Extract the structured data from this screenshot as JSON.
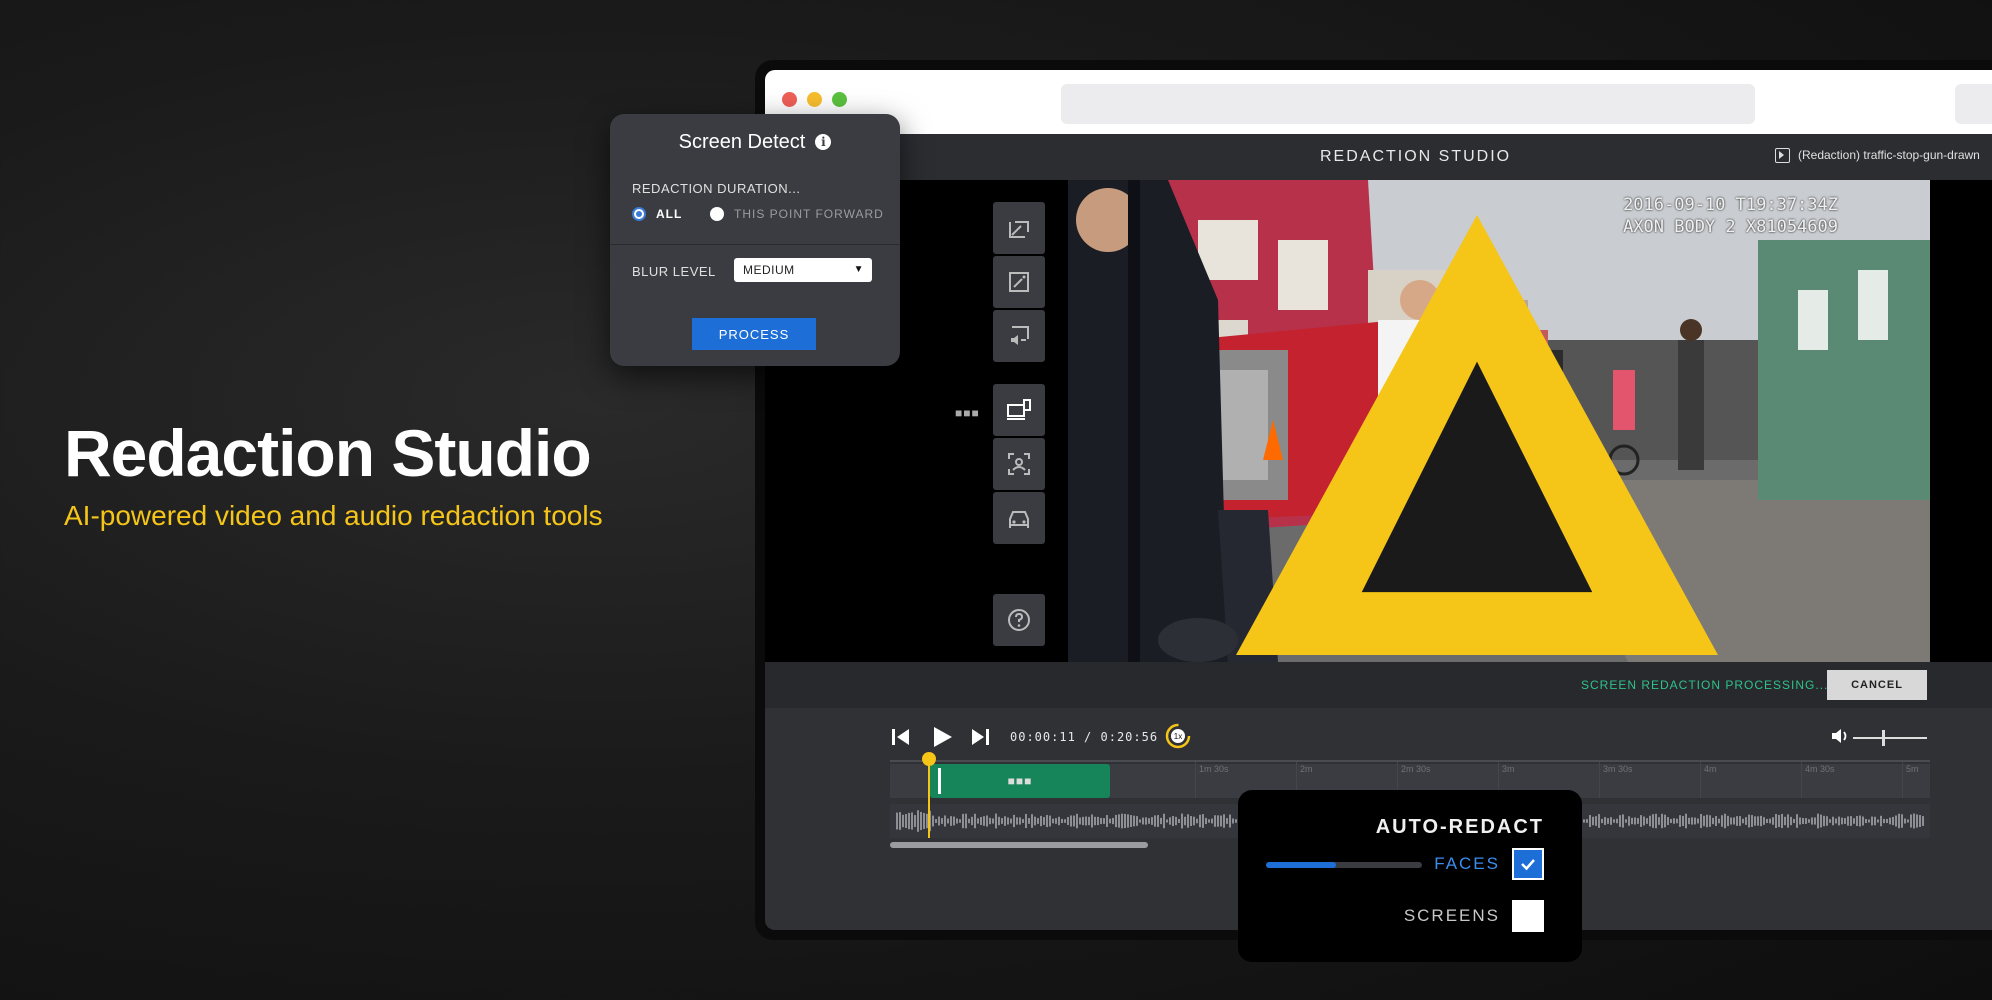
{
  "hero": {
    "title": "Redaction Studio",
    "subtitle": "AI-powered video and audio redaction tools"
  },
  "app": {
    "title": "REDACTION STUDIO",
    "file_name": "(Redaction) traffic-stop-gun-drawn"
  },
  "video": {
    "timestamp_line1": "2016-09-10 T19:37:34Z",
    "timestamp_line2": "AXON BODY 2 X81054609"
  },
  "toolbar": {
    "tools": [
      "draw-box-icon",
      "magic-wand-icon",
      "audio-redact-icon",
      "screen-detect-icon",
      "face-detect-icon",
      "vehicle-detect-icon"
    ],
    "help": "help-icon"
  },
  "status": {
    "text": "SCREEN REDACTION PROCESSING...",
    "cancel_label": "CANCEL"
  },
  "playback": {
    "current_time": "00:00:11",
    "separator": "/",
    "duration": "0:20:56",
    "speed": "1x",
    "volume_level": 0.4
  },
  "timeline": {
    "tick_labels": [
      "1m 30s",
      "2m",
      "2m 30s",
      "3m",
      "3m 30s",
      "4m",
      "4m 30s",
      "5m"
    ]
  },
  "screen_detect_panel": {
    "title": "Screen Detect",
    "duration_label": "REDACTION DURATION...",
    "option_all": "ALL",
    "option_forward": "THIS POINT FORWARD",
    "selected_option": "ALL",
    "blur_label": "BLUR LEVEL",
    "blur_value": "MEDIUM",
    "process_label": "PROCESS"
  },
  "auto_redact": {
    "title": "AUTO-REDACT",
    "faces_label": "FACES",
    "faces_checked": true,
    "faces_progress": 0.45,
    "screens_label": "SCREENS",
    "screens_checked": false
  },
  "colors": {
    "accent_yellow": "#f5c518",
    "accent_blue": "#1d6ed6",
    "status_green": "#2fc28a",
    "segment_green": "#16855a"
  }
}
